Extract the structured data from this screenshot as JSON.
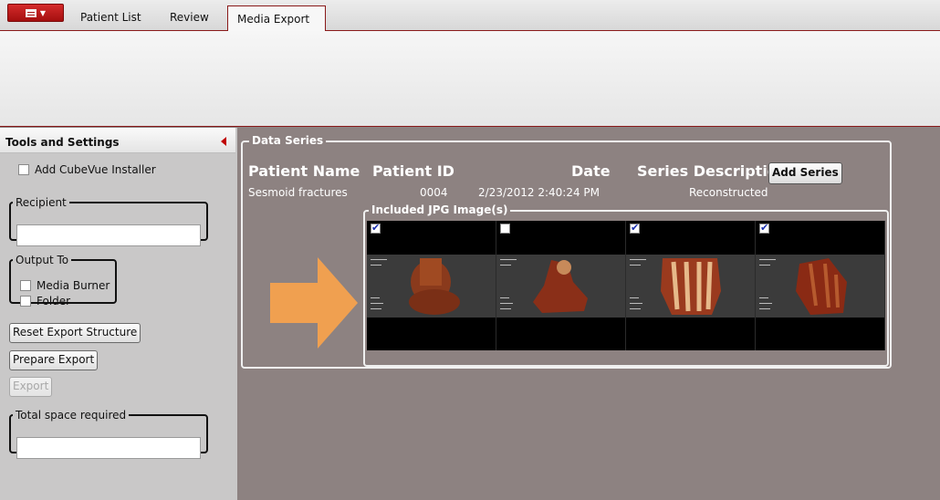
{
  "tabs": [
    {
      "label": "Patient List",
      "active": false
    },
    {
      "label": "Review",
      "active": false
    },
    {
      "label": "Media Export",
      "active": true
    }
  ],
  "colors": {
    "accent": "#a40f0f",
    "content_bg": "#8d8281",
    "panel_bg": "#c9c8c8",
    "arrow": "#f0a050",
    "check": "#1a2fb0"
  },
  "left_panel": {
    "title": "Tools and Settings",
    "add_installer": {
      "label": "Add CubeVue Installer",
      "checked": false
    },
    "recipient": {
      "legend": "Recipient",
      "value": ""
    },
    "output_to": {
      "legend": "Output To",
      "options": [
        {
          "label": "Media Burner",
          "checked": false
        },
        {
          "label": "Folder",
          "checked": false
        }
      ]
    },
    "buttons": {
      "reset": "Reset Export Structure",
      "prepare": "Prepare Export",
      "export": "Export"
    },
    "total_space": {
      "legend": "Total space required",
      "value": ""
    }
  },
  "data_series": {
    "legend": "Data Series",
    "columns": {
      "patient_name": "Patient Name",
      "patient_id": "Patient ID",
      "date": "Date",
      "series_description": "Series Description"
    },
    "row": {
      "patient_name": "Sesmoid fractures",
      "patient_id": "0004",
      "date": "2/23/2012 2:40:24 PM",
      "series_description": "Reconstructed"
    },
    "add_series_label": "Add Series",
    "images": {
      "legend": "Included JPG Image(s)",
      "thumbnails": [
        {
          "checked": true,
          "icon": "foot-render-image"
        },
        {
          "checked": false,
          "icon": "foot-render-image"
        },
        {
          "checked": true,
          "icon": "foot-render-image"
        },
        {
          "checked": true,
          "icon": "foot-render-image"
        }
      ]
    }
  }
}
